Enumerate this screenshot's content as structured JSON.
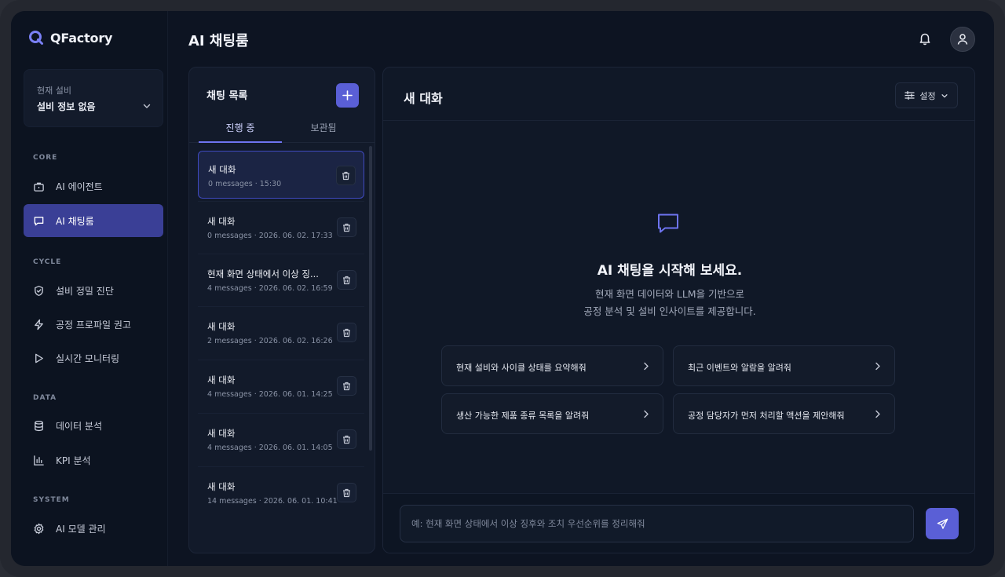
{
  "app": {
    "name": "QFactory"
  },
  "equipment": {
    "label": "현재 설비",
    "value": "설비 정보 없음"
  },
  "sidebar": {
    "sections": [
      {
        "title": "CORE",
        "items": [
          {
            "label": "AI 에이전트",
            "icon": "briefcase-icon"
          },
          {
            "label": "AI 채팅룸",
            "icon": "chat-icon",
            "active": true
          }
        ]
      },
      {
        "title": "CYCLE",
        "items": [
          {
            "label": "설비 정밀 진단",
            "icon": "shield-icon"
          },
          {
            "label": "공정 프로파일 권고",
            "icon": "bolt-icon"
          },
          {
            "label": "실시간 모니터링",
            "icon": "play-icon"
          }
        ]
      },
      {
        "title": "DATA",
        "items": [
          {
            "label": "데이터 분석",
            "icon": "database-icon"
          },
          {
            "label": "KPI 분석",
            "icon": "bar-chart-icon"
          }
        ]
      },
      {
        "title": "SYSTEM",
        "items": [
          {
            "label": "AI 모델 관리",
            "icon": "gear-icon"
          }
        ]
      }
    ]
  },
  "header": {
    "title": "AI 채팅룸"
  },
  "chat_list": {
    "title": "채팅 목록",
    "tabs": [
      {
        "label": "진행 중",
        "active": true
      },
      {
        "label": "보관됨"
      }
    ],
    "items": [
      {
        "name": "새 대화",
        "meta": "0 messages · 15:30",
        "active": true
      },
      {
        "name": "새 대화",
        "meta": "0 messages · 2026. 06. 02. 17:33"
      },
      {
        "name": "현재 화면 상태에서 이상 징...",
        "meta": "4 messages · 2026. 06. 02. 16:59"
      },
      {
        "name": "새 대화",
        "meta": "2 messages · 2026. 06. 02. 16:26"
      },
      {
        "name": "새 대화",
        "meta": "4 messages · 2026. 06. 01. 14:25"
      },
      {
        "name": "새 대화",
        "meta": "4 messages · 2026. 06. 01. 14:05"
      },
      {
        "name": "새 대화",
        "meta": "14 messages · 2026. 06. 01. 10:41"
      }
    ]
  },
  "chat": {
    "title": "새 대화",
    "settings_label": "설정",
    "welcome_title": "AI 채팅을 시작해 보세요.",
    "welcome_line1": "현재 화면 데이터와 LLM을 기반으로",
    "welcome_line2": "공정 분석 및 설비 인사이트를 제공합니다.",
    "suggestions": [
      "현재 설비와 사이클 상태를 요약해줘",
      "최근 이벤트와 알람을 알려줘",
      "생산 가능한 제품 종류 목록을 알려줘",
      "공정 담당자가 먼저 처리할 액션을 제안해줘"
    ],
    "input_placeholder": "예: 현재 화면 상태에서 이상 징후와 조치 우선순위를 정리해줘"
  },
  "colors": {
    "accent": "#5a5fd6",
    "active_nav": "#3a3f96",
    "background": "#0d1422"
  }
}
